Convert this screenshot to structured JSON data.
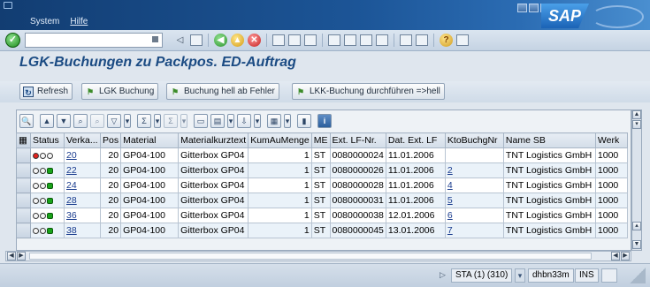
{
  "menu": [
    "System",
    "Hilfe"
  ],
  "brand": "SAP",
  "command_field": {
    "value": ""
  },
  "screen_title": "LGK-Buchungen zu Packpos. ED-Auftrag",
  "app_toolbar": [
    {
      "label": "Refresh",
      "icon": "refresh-icon"
    },
    {
      "label": "LGK Buchung",
      "icon": "flag-icon"
    },
    {
      "label": "Buchung hell ab Fehler",
      "icon": "flag-icon"
    },
    {
      "label": "LKK-Buchung durchführen =>hell",
      "icon": "flag-icon"
    }
  ],
  "table": {
    "headers": [
      "Status",
      "Verka...",
      "Pos",
      "Material",
      "Materialkurztext",
      "KumAuMenge",
      "ME",
      "Ext. LF-Nr.",
      "Dat. Ext. LF",
      "KtoBuchgNr",
      "Name SB",
      "Werk"
    ],
    "rows": [
      {
        "status": "red",
        "verka": "20",
        "pos": "20",
        "material": "GP04-100",
        "kurztext": "Gitterbox GP04",
        "menge": "1",
        "me": "ST",
        "lf_nr": "0080000024",
        "datum": "11.01.2006",
        "kto": "",
        "name_sb": "TNT Logistics GmbH",
        "werk": "1000"
      },
      {
        "status": "green",
        "verka": "22",
        "pos": "20",
        "material": "GP04-100",
        "kurztext": "Gitterbox GP04",
        "menge": "1",
        "me": "ST",
        "lf_nr": "0080000026",
        "datum": "11.01.2006",
        "kto": "2",
        "name_sb": "TNT Logistics GmbH",
        "werk": "1000"
      },
      {
        "status": "green",
        "verka": "24",
        "pos": "20",
        "material": "GP04-100",
        "kurztext": "Gitterbox GP04",
        "menge": "1",
        "me": "ST",
        "lf_nr": "0080000028",
        "datum": "11.01.2006",
        "kto": "4",
        "name_sb": "TNT Logistics GmbH",
        "werk": "1000"
      },
      {
        "status": "green",
        "verka": "28",
        "pos": "20",
        "material": "GP04-100",
        "kurztext": "Gitterbox GP04",
        "menge": "1",
        "me": "ST",
        "lf_nr": "0080000031",
        "datum": "11.01.2006",
        "kto": "5",
        "name_sb": "TNT Logistics GmbH",
        "werk": "1000"
      },
      {
        "status": "green",
        "verka": "36",
        "pos": "20",
        "material": "GP04-100",
        "kurztext": "Gitterbox GP04",
        "menge": "1",
        "me": "ST",
        "lf_nr": "0080000038",
        "datum": "12.01.2006",
        "kto": "6",
        "name_sb": "TNT Logistics GmbH",
        "werk": "1000"
      },
      {
        "status": "green",
        "verka": "38",
        "pos": "20",
        "material": "GP04-100",
        "kurztext": "Gitterbox GP04",
        "menge": "1",
        "me": "ST",
        "lf_nr": "0080000045",
        "datum": "13.01.2006",
        "kto": "7",
        "name_sb": "TNT Logistics GmbH",
        "werk": "1000"
      }
    ]
  },
  "status_bar": {
    "system": "STA (1) (310)",
    "server": "dhbn33m",
    "mode": "INS"
  }
}
